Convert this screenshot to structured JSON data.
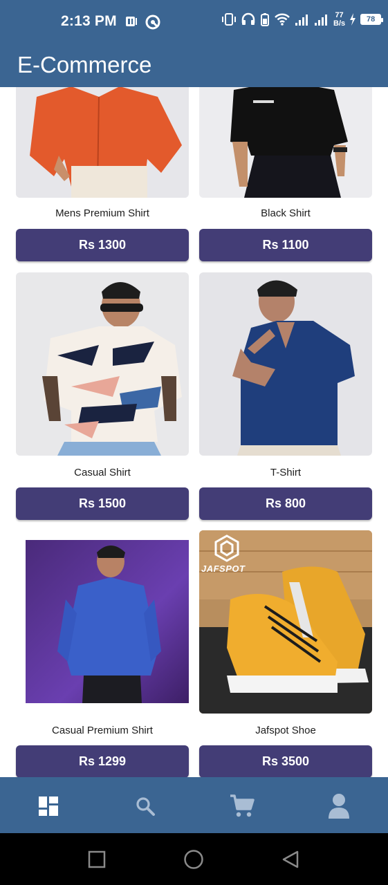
{
  "status_bar": {
    "time": "2:13 PM",
    "net_speed_value": "77",
    "net_speed_unit": "B/s",
    "battery_level": "78",
    "icons": [
      "notification-icon",
      "vpn-icon",
      "vibrate-icon",
      "headset-icon",
      "wifi-icon",
      "signal-icon",
      "signal-icon",
      "charging-icon"
    ]
  },
  "app_bar": {
    "title": "E-Commerce"
  },
  "products": [
    {
      "name": "Mens Premium Shirt",
      "price": "Rs 1300"
    },
    {
      "name": "Black Shirt",
      "price": "Rs 1100"
    },
    {
      "name": "Casual Shirt",
      "price": "Rs 1500"
    },
    {
      "name": "T-Shirt",
      "price": "Rs 800"
    },
    {
      "name": "Casual Premium Shirt",
      "price": "Rs 1299"
    },
    {
      "name": "Jafspot Shoe",
      "price": "Rs 3500"
    }
  ],
  "image_overlays": {
    "jafspot_logo_text": "JAFSPOT"
  },
  "bottom_nav": {
    "items": [
      "dashboard-icon",
      "search-icon",
      "cart-icon",
      "profile-icon"
    ],
    "active_index": 0
  },
  "system_nav": {
    "buttons": [
      "recents-button",
      "home-button",
      "back-button"
    ]
  },
  "colors": {
    "primary": "#3b6592",
    "button": "#433d76",
    "nav_inactive": "#a9bdd4"
  }
}
